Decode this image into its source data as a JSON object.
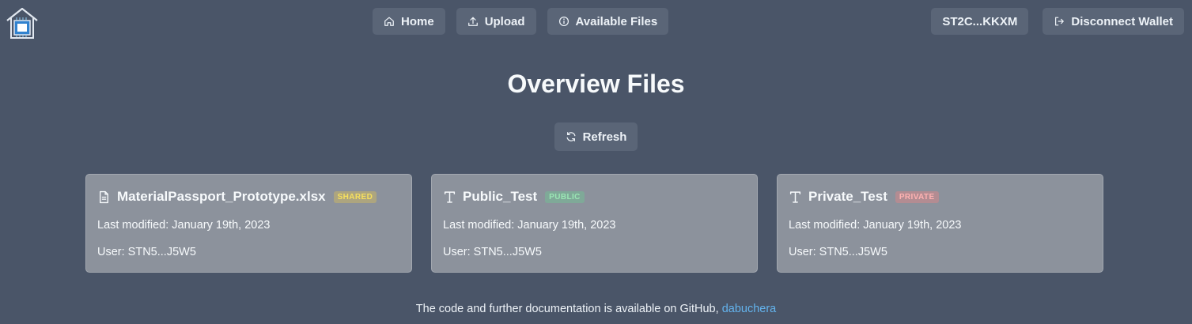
{
  "header": {
    "logo_icon": "house-chip-logo",
    "nav": [
      {
        "label": "Home",
        "icon": "home-icon"
      },
      {
        "label": "Upload",
        "icon": "upload-icon"
      },
      {
        "label": "Available Files",
        "icon": "info-icon"
      }
    ],
    "wallet_address": "ST2C...KKXM",
    "disconnect_label": "Disconnect Wallet",
    "disconnect_icon": "logout-icon"
  },
  "main": {
    "title": "Overview Files",
    "refresh_label": "Refresh",
    "files": [
      {
        "name": "MaterialPassport_Prototype.xlsx",
        "icon": "document-icon",
        "badge": "SHARED",
        "modified": "Last modified: January 19th, 2023",
        "user": "User: STN5...J5W5"
      },
      {
        "name": "Public_Test",
        "icon": "text-icon",
        "badge": "PUBLIC",
        "modified": "Last modified: January 19th, 2023",
        "user": "User: STN5...J5W5"
      },
      {
        "name": "Private_Test",
        "icon": "text-icon",
        "badge": "PRIVATE",
        "modified": "Last modified: January 19th, 2023",
        "user": "User: STN5...J5W5"
      }
    ]
  },
  "footer": {
    "text": "The code and further documentation is available on GitHub,",
    "link_label": "dabuchera"
  },
  "colors": {
    "background": "#4a5568",
    "button": "#5a6577",
    "card": "#8c929c",
    "link": "#63b3ed",
    "badge_shared": "#f6e05e",
    "badge_public": "#9ae6b4",
    "badge_private": "#feb2b2"
  }
}
